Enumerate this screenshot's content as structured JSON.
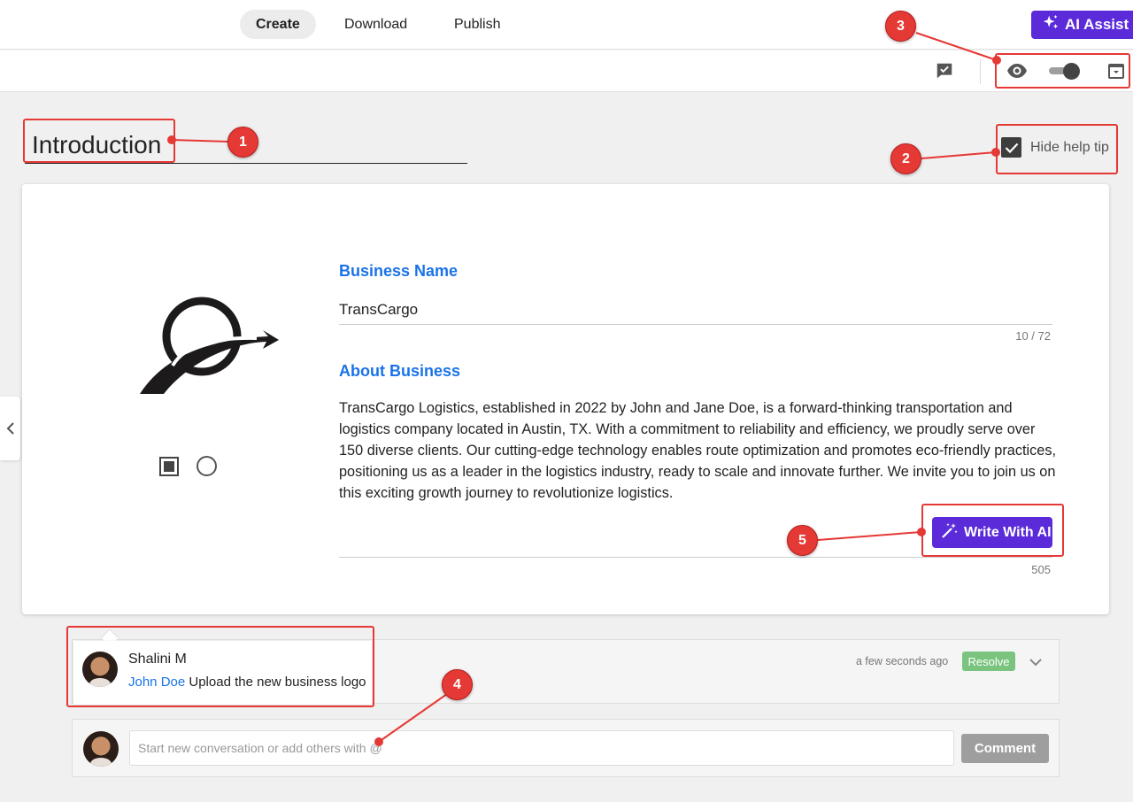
{
  "nav": {
    "tabs": [
      {
        "label": "Create"
      },
      {
        "label": "Download"
      },
      {
        "label": "Publish"
      }
    ],
    "ai_assist_label": "AI Assist"
  },
  "section": {
    "title": "Introduction",
    "hide_help_tip_label": "Hide help tip",
    "hide_help_tip_checked": true
  },
  "form": {
    "business_name_label": "Business Name",
    "business_name_value": "TransCargo",
    "business_name_counter": "10 / 72",
    "about_label": "About Business",
    "about_value": "TransCargo Logistics, established in 2022 by John and Jane Doe, is a forward-thinking transportation and logistics company located in Austin, TX. With a commitment to reliability and efficiency, we proudly serve over 150 diverse clients. Our cutting-edge technology enables route optimization and promotes eco-friendly practices, positioning us as a leader in the logistics industry, ready to scale and innovate further. We invite you to join us on this exciting growth journey to revolutionize logistics.",
    "about_counter": "505",
    "write_ai_label": "Write With AI"
  },
  "comments": {
    "thread": {
      "author": "Shalini M",
      "mention": "John Doe",
      "text": " Upload the new business logo",
      "time": "a few seconds ago",
      "resolve_label": "Resolve"
    },
    "new": {
      "placeholder": "Start new conversation or add others with @",
      "button_label": "Comment"
    }
  },
  "annotations": [
    "1",
    "2",
    "3",
    "4",
    "5"
  ],
  "colors": {
    "accent_purple": "#5b2bd9",
    "link_blue": "#1a73e8",
    "annotation_red": "#e53935",
    "resolve_green": "#7bc47f"
  }
}
